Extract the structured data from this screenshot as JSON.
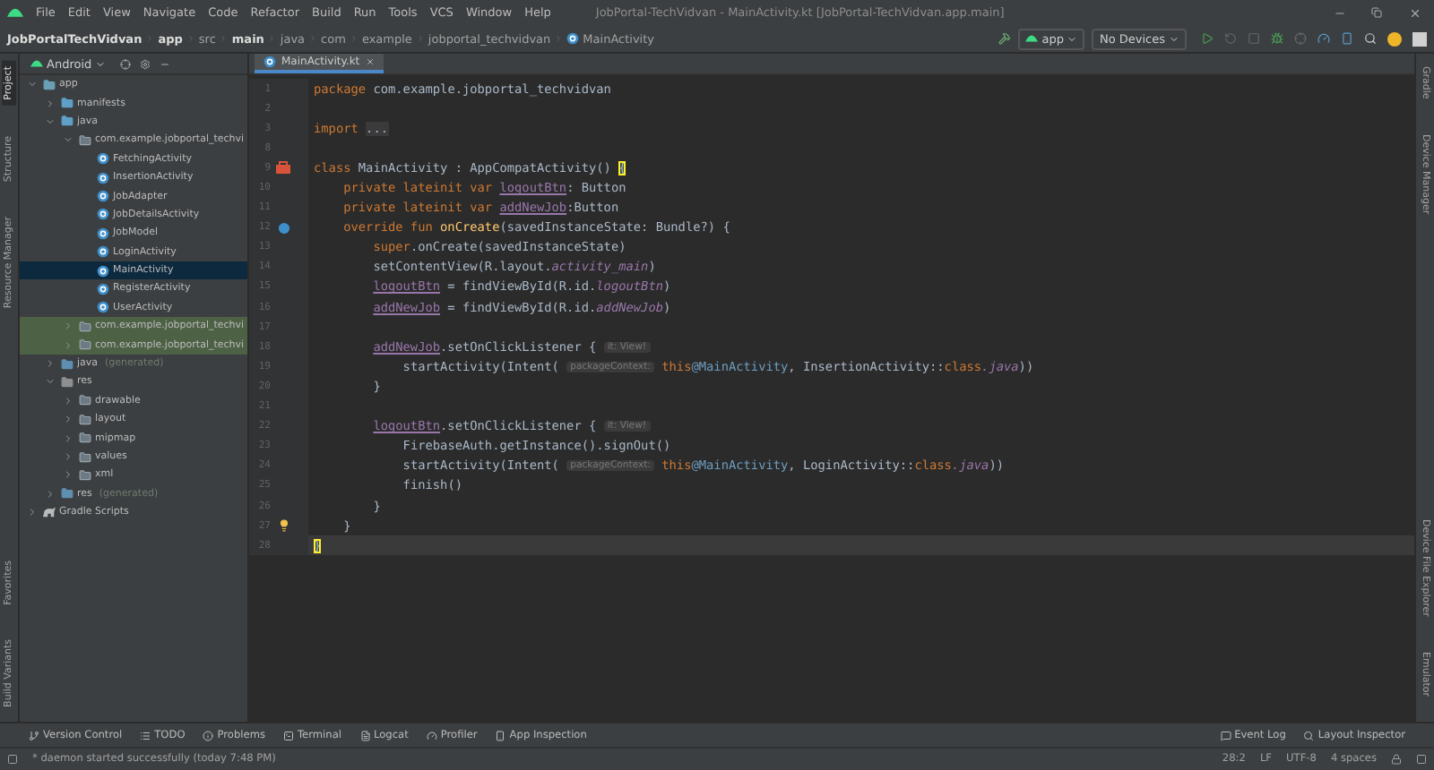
{
  "menu": [
    "File",
    "Edit",
    "View",
    "Navigate",
    "Code",
    "Refactor",
    "Build",
    "Run",
    "Tools",
    "VCS",
    "Window",
    "Help"
  ],
  "window_title": "JobPortal-TechVidvan - MainActivity.kt [JobPortal-TechVidvan.app.main]",
  "breadcrumbs": [
    "JobPortalTechVidvan",
    "app",
    "src",
    "main",
    "java",
    "com",
    "example",
    "jobportal_techvidvan",
    "MainActivity"
  ],
  "toolbar": {
    "run_config": "app",
    "device": "No Devices"
  },
  "left_stripe": [
    {
      "label": "Project",
      "selected": true
    },
    {
      "label": "Structure",
      "selected": false
    },
    {
      "label": "Resource Manager",
      "selected": false
    },
    {
      "label": "Favorites",
      "selected": false
    },
    {
      "label": "Build Variants",
      "selected": false
    }
  ],
  "right_stripe": [
    {
      "label": "Gradle",
      "selected": false
    },
    {
      "label": "Device Manager",
      "selected": false
    },
    {
      "label": "Device File Explorer",
      "selected": false
    },
    {
      "label": "Emulator",
      "selected": false
    }
  ],
  "project_panel": {
    "view": "Android",
    "tree": [
      {
        "label": "app",
        "kind": "module",
        "expanded": true,
        "selected": false,
        "highlighted": false,
        "children": [
          {
            "label": "manifests",
            "kind": "folder",
            "expanded": false,
            "selected": false,
            "highlighted": false
          },
          {
            "label": "java",
            "kind": "folder",
            "expanded": true,
            "selected": false,
            "highlighted": false,
            "children": [
              {
                "label": "com.example.jobportal_techvi",
                "kind": "package",
                "expanded": true,
                "selected": false,
                "highlighted": false,
                "children": [
                  {
                    "label": "FetchingActivity",
                    "kind": "class",
                    "selected": false,
                    "highlighted": false
                  },
                  {
                    "label": "InsertionActivity",
                    "kind": "class",
                    "selected": false,
                    "highlighted": false
                  },
                  {
                    "label": "JobAdapter",
                    "kind": "class",
                    "selected": false,
                    "highlighted": false
                  },
                  {
                    "label": "JobDetailsActivity",
                    "kind": "class",
                    "selected": false,
                    "highlighted": false
                  },
                  {
                    "label": "JobModel",
                    "kind": "class",
                    "selected": false,
                    "highlighted": false
                  },
                  {
                    "label": "LoginActivity",
                    "kind": "class",
                    "selected": false,
                    "highlighted": false
                  },
                  {
                    "label": "MainActivity",
                    "kind": "class",
                    "selected": true,
                    "highlighted": false
                  },
                  {
                    "label": "RegisterActivity",
                    "kind": "class",
                    "selected": false,
                    "highlighted": false
                  },
                  {
                    "label": "UserActivity",
                    "kind": "class",
                    "selected": false,
                    "highlighted": false
                  }
                ]
              },
              {
                "label": "com.example.jobportal_techvi",
                "kind": "package",
                "expanded": false,
                "selected": false,
                "highlighted": true
              },
              {
                "label": "com.example.jobportal_techvi",
                "kind": "package",
                "expanded": false,
                "selected": false,
                "highlighted": true
              }
            ]
          },
          {
            "label": "java",
            "note": "(generated)",
            "kind": "genfolder",
            "expanded": false,
            "selected": false,
            "highlighted": false
          },
          {
            "label": "res",
            "kind": "resfolder",
            "expanded": true,
            "selected": false,
            "highlighted": false,
            "children": [
              {
                "label": "drawable",
                "kind": "package",
                "expanded": false,
                "selected": false,
                "highlighted": false
              },
              {
                "label": "layout",
                "kind": "package",
                "expanded": false,
                "selected": false,
                "highlighted": false
              },
              {
                "label": "mipmap",
                "kind": "package",
                "expanded": false,
                "selected": false,
                "highlighted": false
              },
              {
                "label": "values",
                "kind": "package",
                "expanded": false,
                "selected": false,
                "highlighted": false
              },
              {
                "label": "xml",
                "kind": "package",
                "expanded": false,
                "selected": false,
                "highlighted": false
              }
            ]
          },
          {
            "label": "res",
            "note": "(generated)",
            "kind": "genfolder",
            "expanded": false,
            "selected": false,
            "highlighted": false
          }
        ]
      },
      {
        "label": "Gradle Scripts",
        "kind": "gradle",
        "expanded": false,
        "selected": false,
        "highlighted": false
      }
    ]
  },
  "editor_tabs": [
    {
      "label": "MainActivity.kt",
      "selected": true
    }
  ],
  "code": [
    {
      "number": "1",
      "tokens": [
        {
          "t": "package ",
          "kind": "kw"
        },
        {
          "t": "com.example.jobportal_techvidvan",
          "kind": "plain"
        }
      ]
    },
    {
      "number": "2"
    },
    {
      "number": "3",
      "tokens": [
        {
          "t": "import ",
          "kind": "kw"
        },
        {
          "t": "...",
          "kind": "fold"
        }
      ]
    },
    {
      "number": "8"
    },
    {
      "number": "9",
      "marker": {
        "kind": "class"
      },
      "tokens": [
        {
          "t": "class ",
          "kind": "kw"
        },
        {
          "t": "MainActivity : AppCompatActivity() ",
          "kind": "plain"
        },
        {
          "t": "{",
          "kind": "brace"
        }
      ],
      "children": [
        {
          "number": "10",
          "tokens": [
            {
              "t": "private lateinit var ",
              "kind": "kw"
            },
            {
              "t": "logoutBtn",
              "kind": "field"
            },
            {
              "t": ": Button",
              "kind": "plain"
            }
          ]
        },
        {
          "number": "11",
          "tokens": [
            {
              "t": "private lateinit var ",
              "kind": "kw"
            },
            {
              "t": "addNewJob",
              "kind": "field"
            },
            {
              "t": ":Button",
              "kind": "plain"
            }
          ]
        },
        {
          "number": "12",
          "marker": {
            "kind": "override"
          },
          "tokens": [
            {
              "t": "override fun ",
              "kind": "kw"
            },
            {
              "t": "onCreate",
              "kind": "func"
            },
            {
              "t": "(savedInstanceState: Bundle?) {",
              "kind": "plain"
            }
          ],
          "children": [
            {
              "number": "13",
              "tokens": [
                {
                  "t": "super",
                  "kind": "kw"
                },
                {
                  "t": ".onCreate(savedInstanceState)",
                  "kind": "plain"
                }
              ]
            },
            {
              "number": "14",
              "tokens": [
                {
                  "t": "setContentView(R.layout.",
                  "kind": "plain"
                },
                {
                  "t": "activity_main",
                  "kind": "static"
                },
                {
                  "t": ")",
                  "kind": "plain"
                }
              ]
            },
            {
              "number": "15",
              "tokens": [
                {
                  "t": "logoutBtn",
                  "kind": "field"
                },
                {
                  "t": " = findViewById(R.id.",
                  "kind": "plain"
                },
                {
                  "t": "logoutBtn",
                  "kind": "static"
                },
                {
                  "t": ")",
                  "kind": "plain"
                }
              ]
            },
            {
              "number": "16",
              "tokens": [
                {
                  "t": "addNewJob",
                  "kind": "field"
                },
                {
                  "t": " = findViewById(R.id.",
                  "kind": "plain"
                },
                {
                  "t": "addNewJob",
                  "kind": "static"
                },
                {
                  "t": ")",
                  "kind": "plain"
                }
              ]
            },
            {
              "number": "17"
            },
            {
              "number": "18",
              "tokens": [
                {
                  "t": "addNewJob",
                  "kind": "field"
                },
                {
                  "t": ".setOnClickListener { ",
                  "kind": "plain"
                },
                {
                  "t": "it: View!",
                  "kind": "hint"
                }
              ],
              "children": [
                {
                  "number": "19",
                  "tokens": [
                    {
                      "t": "startActivity(Intent( ",
                      "kind": "plain"
                    },
                    {
                      "t": "packageContext:",
                      "kind": "hint"
                    },
                    {
                      "t": " this",
                      "kind": "kw"
                    },
                    {
                      "t": "@MainActivity",
                      "kind": "label"
                    },
                    {
                      "t": ", InsertionActivity::",
                      "kind": "plain"
                    },
                    {
                      "t": "class",
                      "kind": "kw"
                    },
                    {
                      "t": ".java",
                      "kind": "static"
                    },
                    {
                      "t": "))",
                      "kind": "plain"
                    }
                  ]
                }
              ]
            },
            {
              "number": "20",
              "tokens": [
                {
                  "t": "}",
                  "kind": "plain"
                }
              ]
            },
            {
              "number": "21"
            },
            {
              "number": "22",
              "tokens": [
                {
                  "t": "logoutBtn",
                  "kind": "field"
                },
                {
                  "t": ".setOnClickListener { ",
                  "kind": "plain"
                },
                {
                  "t": "it: View!",
                  "kind": "hint"
                }
              ],
              "children": [
                {
                  "number": "23",
                  "tokens": [
                    {
                      "t": "FirebaseAuth.getInstance().signOut()",
                      "kind": "plain"
                    }
                  ]
                },
                {
                  "number": "24",
                  "tokens": [
                    {
                      "t": "startActivity(Intent( ",
                      "kind": "plain"
                    },
                    {
                      "t": "packageContext:",
                      "kind": "hint"
                    },
                    {
                      "t": " this",
                      "kind": "kw"
                    },
                    {
                      "t": "@MainActivity",
                      "kind": "label"
                    },
                    {
                      "t": ", LoginActivity::",
                      "kind": "plain"
                    },
                    {
                      "t": "class",
                      "kind": "kw"
                    },
                    {
                      "t": ".java",
                      "kind": "static"
                    },
                    {
                      "t": "))",
                      "kind": "plain"
                    }
                  ]
                },
                {
                  "number": "25",
                  "tokens": [
                    {
                      "t": "finish()",
                      "kind": "plain"
                    }
                  ]
                }
              ]
            },
            {
              "number": "26",
              "tokens": [
                {
                  "t": "}",
                  "kind": "plain"
                }
              ]
            }
          ]
        },
        {
          "number": "27",
          "marker": {
            "kind": "bulb"
          },
          "tokens": [
            {
              "t": "}",
              "kind": "plain"
            }
          ]
        }
      ]
    },
    {
      "number": "28",
      "current": true,
      "tokens": [
        {
          "t": "}",
          "kind": "brace"
        }
      ]
    }
  ],
  "tool_windows": [
    "Version Control",
    "TODO",
    "Problems",
    "Terminal",
    "Logcat",
    "Profiler",
    "App Inspection"
  ],
  "right_tool_windows": [
    "Event Log",
    "Layout Inspector"
  ],
  "status": {
    "message": "* daemon started successfully (today 7:48 PM)",
    "position": "28:2",
    "line_ending": "LF",
    "encoding": "UTF-8",
    "indent": "4 spaces"
  }
}
